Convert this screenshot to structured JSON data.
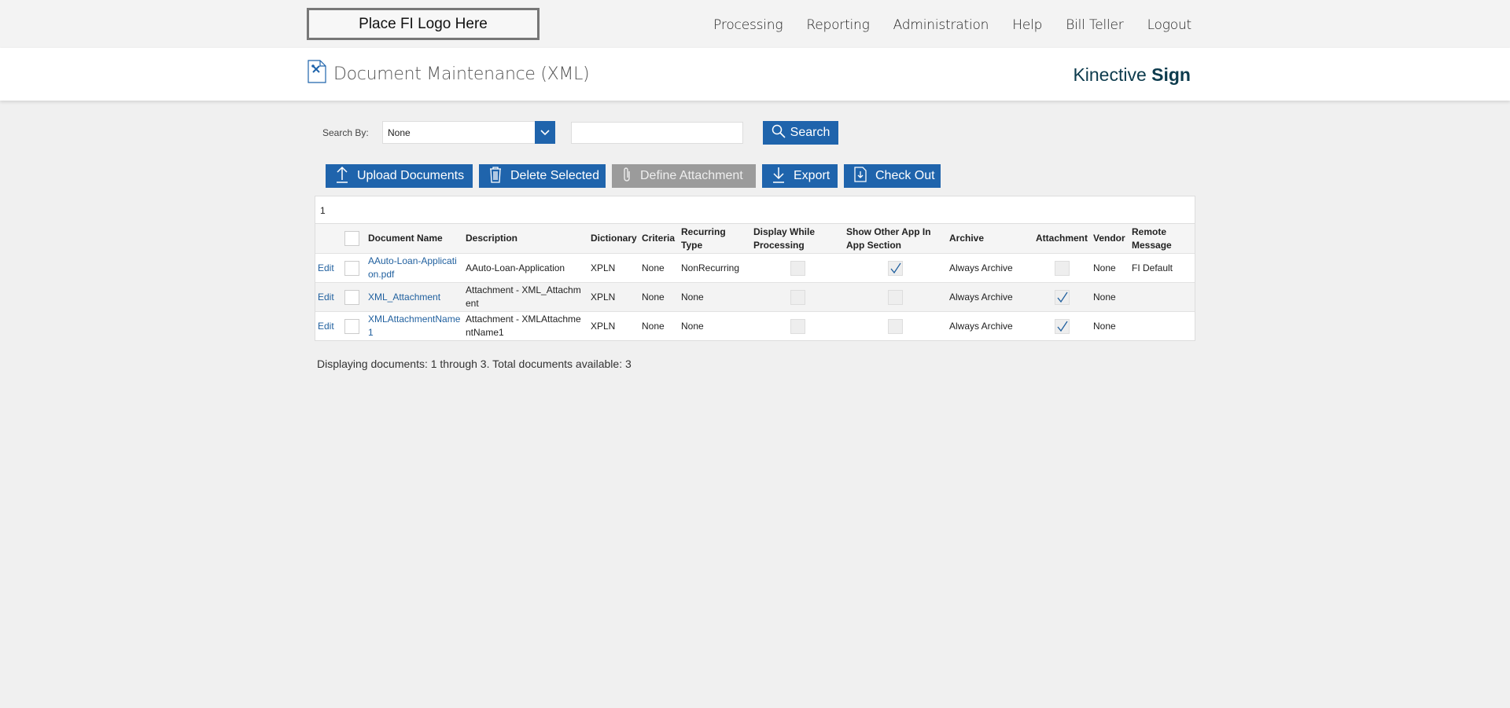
{
  "topbar": {
    "logo_text": "Place FI Logo Here",
    "nav": [
      "Processing",
      "Reporting",
      "Administration",
      "Help",
      "Bill Teller",
      "Logout"
    ]
  },
  "header": {
    "title": "Document Maintenance (XML)",
    "brand_light": "Kinective",
    "brand_bold": "Sign"
  },
  "search": {
    "label": "Search By:",
    "selected": "None",
    "button_label": "Search",
    "text_value": ""
  },
  "toolbar": {
    "upload_label": "Upload Documents",
    "delete_label": "Delete Selected",
    "define_label": "Define Attachment",
    "export_label": "Export",
    "checkout_label": "Check Out"
  },
  "grid": {
    "page": "1",
    "columns": [
      "Document Name",
      "Description",
      "Dictionary",
      "Criteria",
      "Recurring Type",
      "Display While Processing",
      "Show Other App In App Section",
      "Archive",
      "Attachment",
      "Vendor",
      "Remote Message"
    ],
    "edit_label": "Edit",
    "rows": [
      {
        "name": "AAuto-Loan-Application.pdf",
        "description": "AAuto-Loan-Application",
        "dictionary": "XPLN",
        "criteria": "None",
        "recurring": "NonRecurring",
        "display_while_processing": false,
        "show_other_app": true,
        "archive": "Always Archive",
        "attachment": false,
        "vendor": "None",
        "remote_message": "FI Default"
      },
      {
        "name": "XML_Attachment",
        "description": "Attachment - XML_Attachment",
        "dictionary": "XPLN",
        "criteria": "None",
        "recurring": "None",
        "display_while_processing": false,
        "show_other_app": false,
        "archive": "Always Archive",
        "attachment": true,
        "vendor": "None",
        "remote_message": ""
      },
      {
        "name": "XMLAttachmentName1",
        "description": "Attachment - XMLAttachmentName1",
        "dictionary": "XPLN",
        "criteria": "None",
        "recurring": "None",
        "display_while_processing": false,
        "show_other_app": false,
        "archive": "Always Archive",
        "attachment": true,
        "vendor": "None",
        "remote_message": ""
      }
    ]
  },
  "footer": {
    "summary": "Displaying documents: 1 through 3. Total documents available: 3"
  },
  "colors": {
    "primary": "#1f64ac",
    "disabled": "#9b9b9b",
    "brand": "#0d3b4d"
  }
}
